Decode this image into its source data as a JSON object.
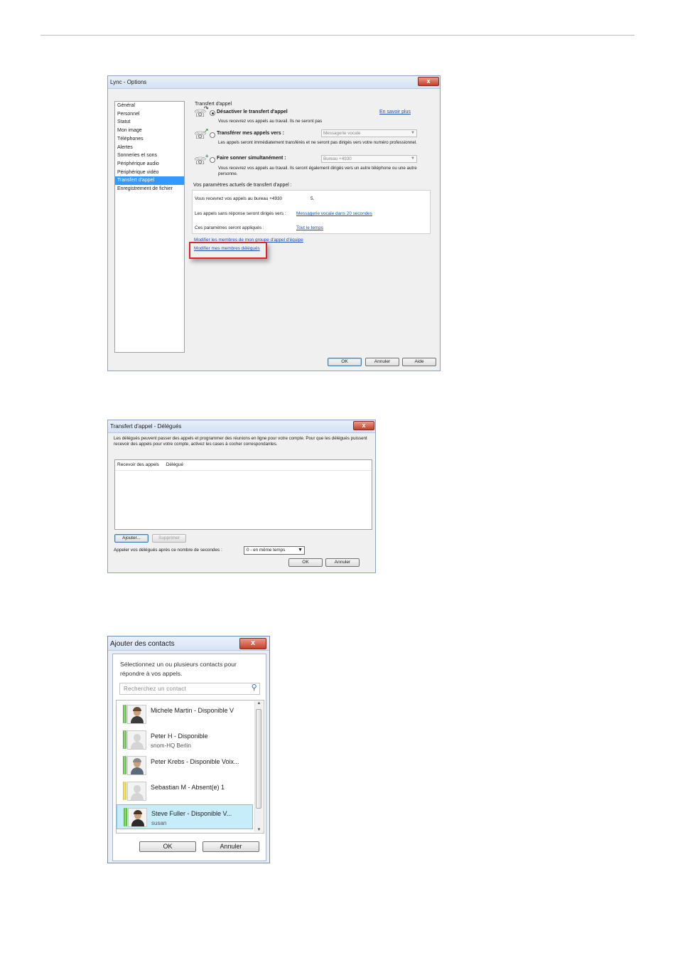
{
  "win1": {
    "title": "Lync - Options",
    "close": "x",
    "nav": [
      "Général",
      "Personnel",
      "Statut",
      "Mon image",
      "Téléphones",
      "Alertes",
      "Sonneries et sons",
      "Périphérique audio",
      "Périphérique vidéo",
      "Transfert d'appel",
      "Enregistrement de fichier"
    ],
    "selected_nav": "Transfert d'appel",
    "section_title": "Transfert d'appel",
    "learn_more": "En savoir plus",
    "opt1_label": "Désactiver le transfert d'appel",
    "opt1_desc": "Vous recevrez vos appels au travail. Ils ne seront pas",
    "opt2_label": "Transférer mes appels vers :",
    "opt2_value": "Messagerie vocale",
    "opt2_desc": "Les appels seront immédiatement transférés et ne seront pas dirigés vers votre numéro professionnel.",
    "opt3_label": "Faire sonner simultanément :",
    "opt3_value": "Bureau +4930",
    "opt3_desc": "Vous recevrez vos appels au travail. Ils seront également dirigés vers un autre téléphone ou une autre personne.",
    "current_title": "Vos paramètres actuels de transfert d'appel :",
    "current_line1": "Vous recevrez vos appels au bureau +4930",
    "current_line1_tail": "5.",
    "current_line2": "Les appels sans réponse seront dirigés vers :",
    "current_line2_link": "Messagerie vocale dans 20 secondes",
    "current_line3": "Ces paramètres seront appliqués :",
    "current_line3_link": "Tout le temps",
    "link_team": "Modifier les membres de mon groupe d'appel d'équipe",
    "link_delegates": "Modifier mes membres délégués",
    "btn_ok": "OK",
    "btn_cancel": "Annuler",
    "btn_help": "Aide"
  },
  "win2": {
    "title": "Transfert d'appel - Délégués",
    "close": "x",
    "description": "Les délégués peuvent passer des appels et programmer des réunions en ligne pour votre compte. Pour que les délégués puissent recevoir des appels pour votre compte, activez les cases à cocher correspondantes.",
    "col1": "Recevoir des appels",
    "col2": "Délégué",
    "btn_add": "Ajouter...",
    "btn_remove": "Supprimer",
    "delay_label": "Appeler vos délégués après ce nombre de secondes :",
    "delay_value": "0 - en même temps",
    "btn_ok": "OK",
    "btn_cancel": "Annuler"
  },
  "win3": {
    "title": "Ajouter des contacts",
    "close": "x",
    "instruction": "Sélectionnez un ou plusieurs contacts pour répondre à vos appels.",
    "search_placeholder": "Recherchez un contact",
    "contacts": [
      {
        "name": "Michele Martin - Disponible  V",
        "sub": "",
        "presence": "green"
      },
      {
        "name": "Peter H          - Disponible",
        "sub": "snom-HQ Berlin",
        "presence": "green"
      },
      {
        "name": "Peter Krebs - Disponible  Voix...",
        "sub": "",
        "presence": "green"
      },
      {
        "name": "Sebastian M          - Absent(e)  1",
        "sub": "",
        "presence": "yellow"
      },
      {
        "name": "Steve Fuller - Disponible  V...",
        "sub": "susan",
        "presence": "green"
      }
    ],
    "btn_ok": "OK",
    "btn_cancel": "Annuler"
  }
}
